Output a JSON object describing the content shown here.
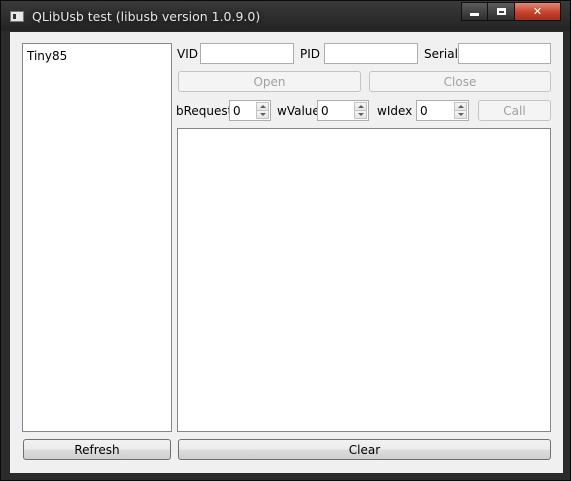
{
  "window": {
    "title": "QLibUsb test (libusb version 1.0.9.0)"
  },
  "device_list": {
    "items": [
      "Tiny85"
    ]
  },
  "fields": {
    "vid_label": "VID",
    "vid_value": "",
    "pid_label": "PID",
    "pid_value": "",
    "serial_label": "Serial",
    "serial_value": ""
  },
  "buttons": {
    "open": "Open",
    "close": "Close",
    "call": "Call",
    "refresh": "Refresh",
    "clear": "Clear"
  },
  "control": {
    "brequest_label": "bRequest",
    "brequest_value": "0",
    "wvalue_label": "wValue",
    "wvalue_value": "0",
    "windex_label": "wIdex",
    "windex_value": "0"
  },
  "output": {
    "text": ""
  }
}
